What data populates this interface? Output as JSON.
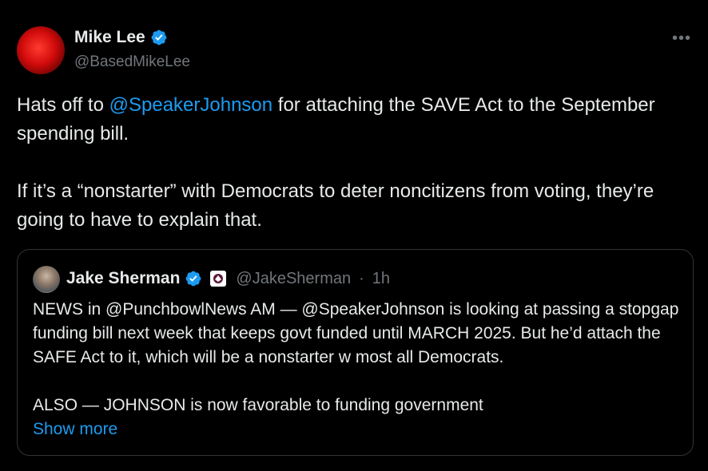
{
  "post": {
    "author_name": "Mike Lee",
    "author_handle": "@BasedMikeLee",
    "text_p1_before": "Hats off to ",
    "text_p1_mention": "@SpeakerJohnson",
    "text_p1_after": " for attaching the SAVE Act to the September spending bill.",
    "text_p2": "If it’s a “nonstarter” with Democrats to deter noncitizens from voting, they’re going to have to explain that."
  },
  "quote": {
    "author_name": "Jake Sherman",
    "author_handle": "@JakeSherman",
    "separator": "·",
    "time": "1h",
    "text_p1": "NEWS in @PunchbowlNews AM — @SpeakerJohnson is looking at passing a stopgap funding bill next week that keeps govt funded until MARCH 2025. But he’d attach the SAFE Act to it, which will be a nonstarter w most all Democrats.",
    "text_p2": "ALSO — JOHNSON is now favorable to funding government",
    "show_more": "Show more"
  },
  "icons": {
    "more": "more-icon",
    "verified": "verified-badge-icon",
    "affiliate": "punchbowl-affiliate-icon"
  },
  "colors": {
    "background": "#000000",
    "text": "#e7e9ea",
    "secondary": "#71767b",
    "accent": "#1d9bf0",
    "border": "#2f3336"
  }
}
